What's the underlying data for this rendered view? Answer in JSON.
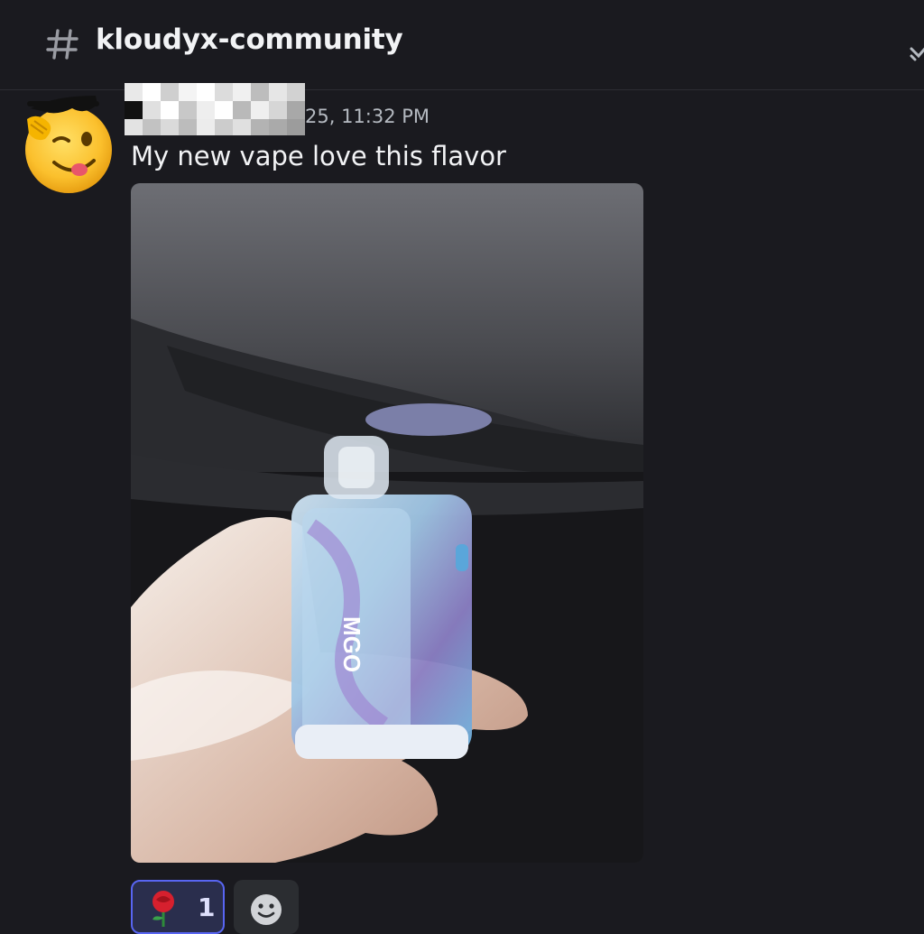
{
  "channel": {
    "icon": "hash-icon",
    "name": "kloudyx-community"
  },
  "message": {
    "author": "",
    "author_obscured": true,
    "timestamp": "25, 11:32 PM",
    "text": "My new vape love this flavor",
    "attachment": {
      "type": "photo",
      "device_brand": "MGO"
    },
    "reactions": [
      {
        "emoji": "rose-icon",
        "count": "1",
        "active": true
      }
    ],
    "add_reaction_icon": "smiley-icon"
  },
  "colors": {
    "background": "#1a1a1f",
    "reaction_active": "#5865f2"
  }
}
